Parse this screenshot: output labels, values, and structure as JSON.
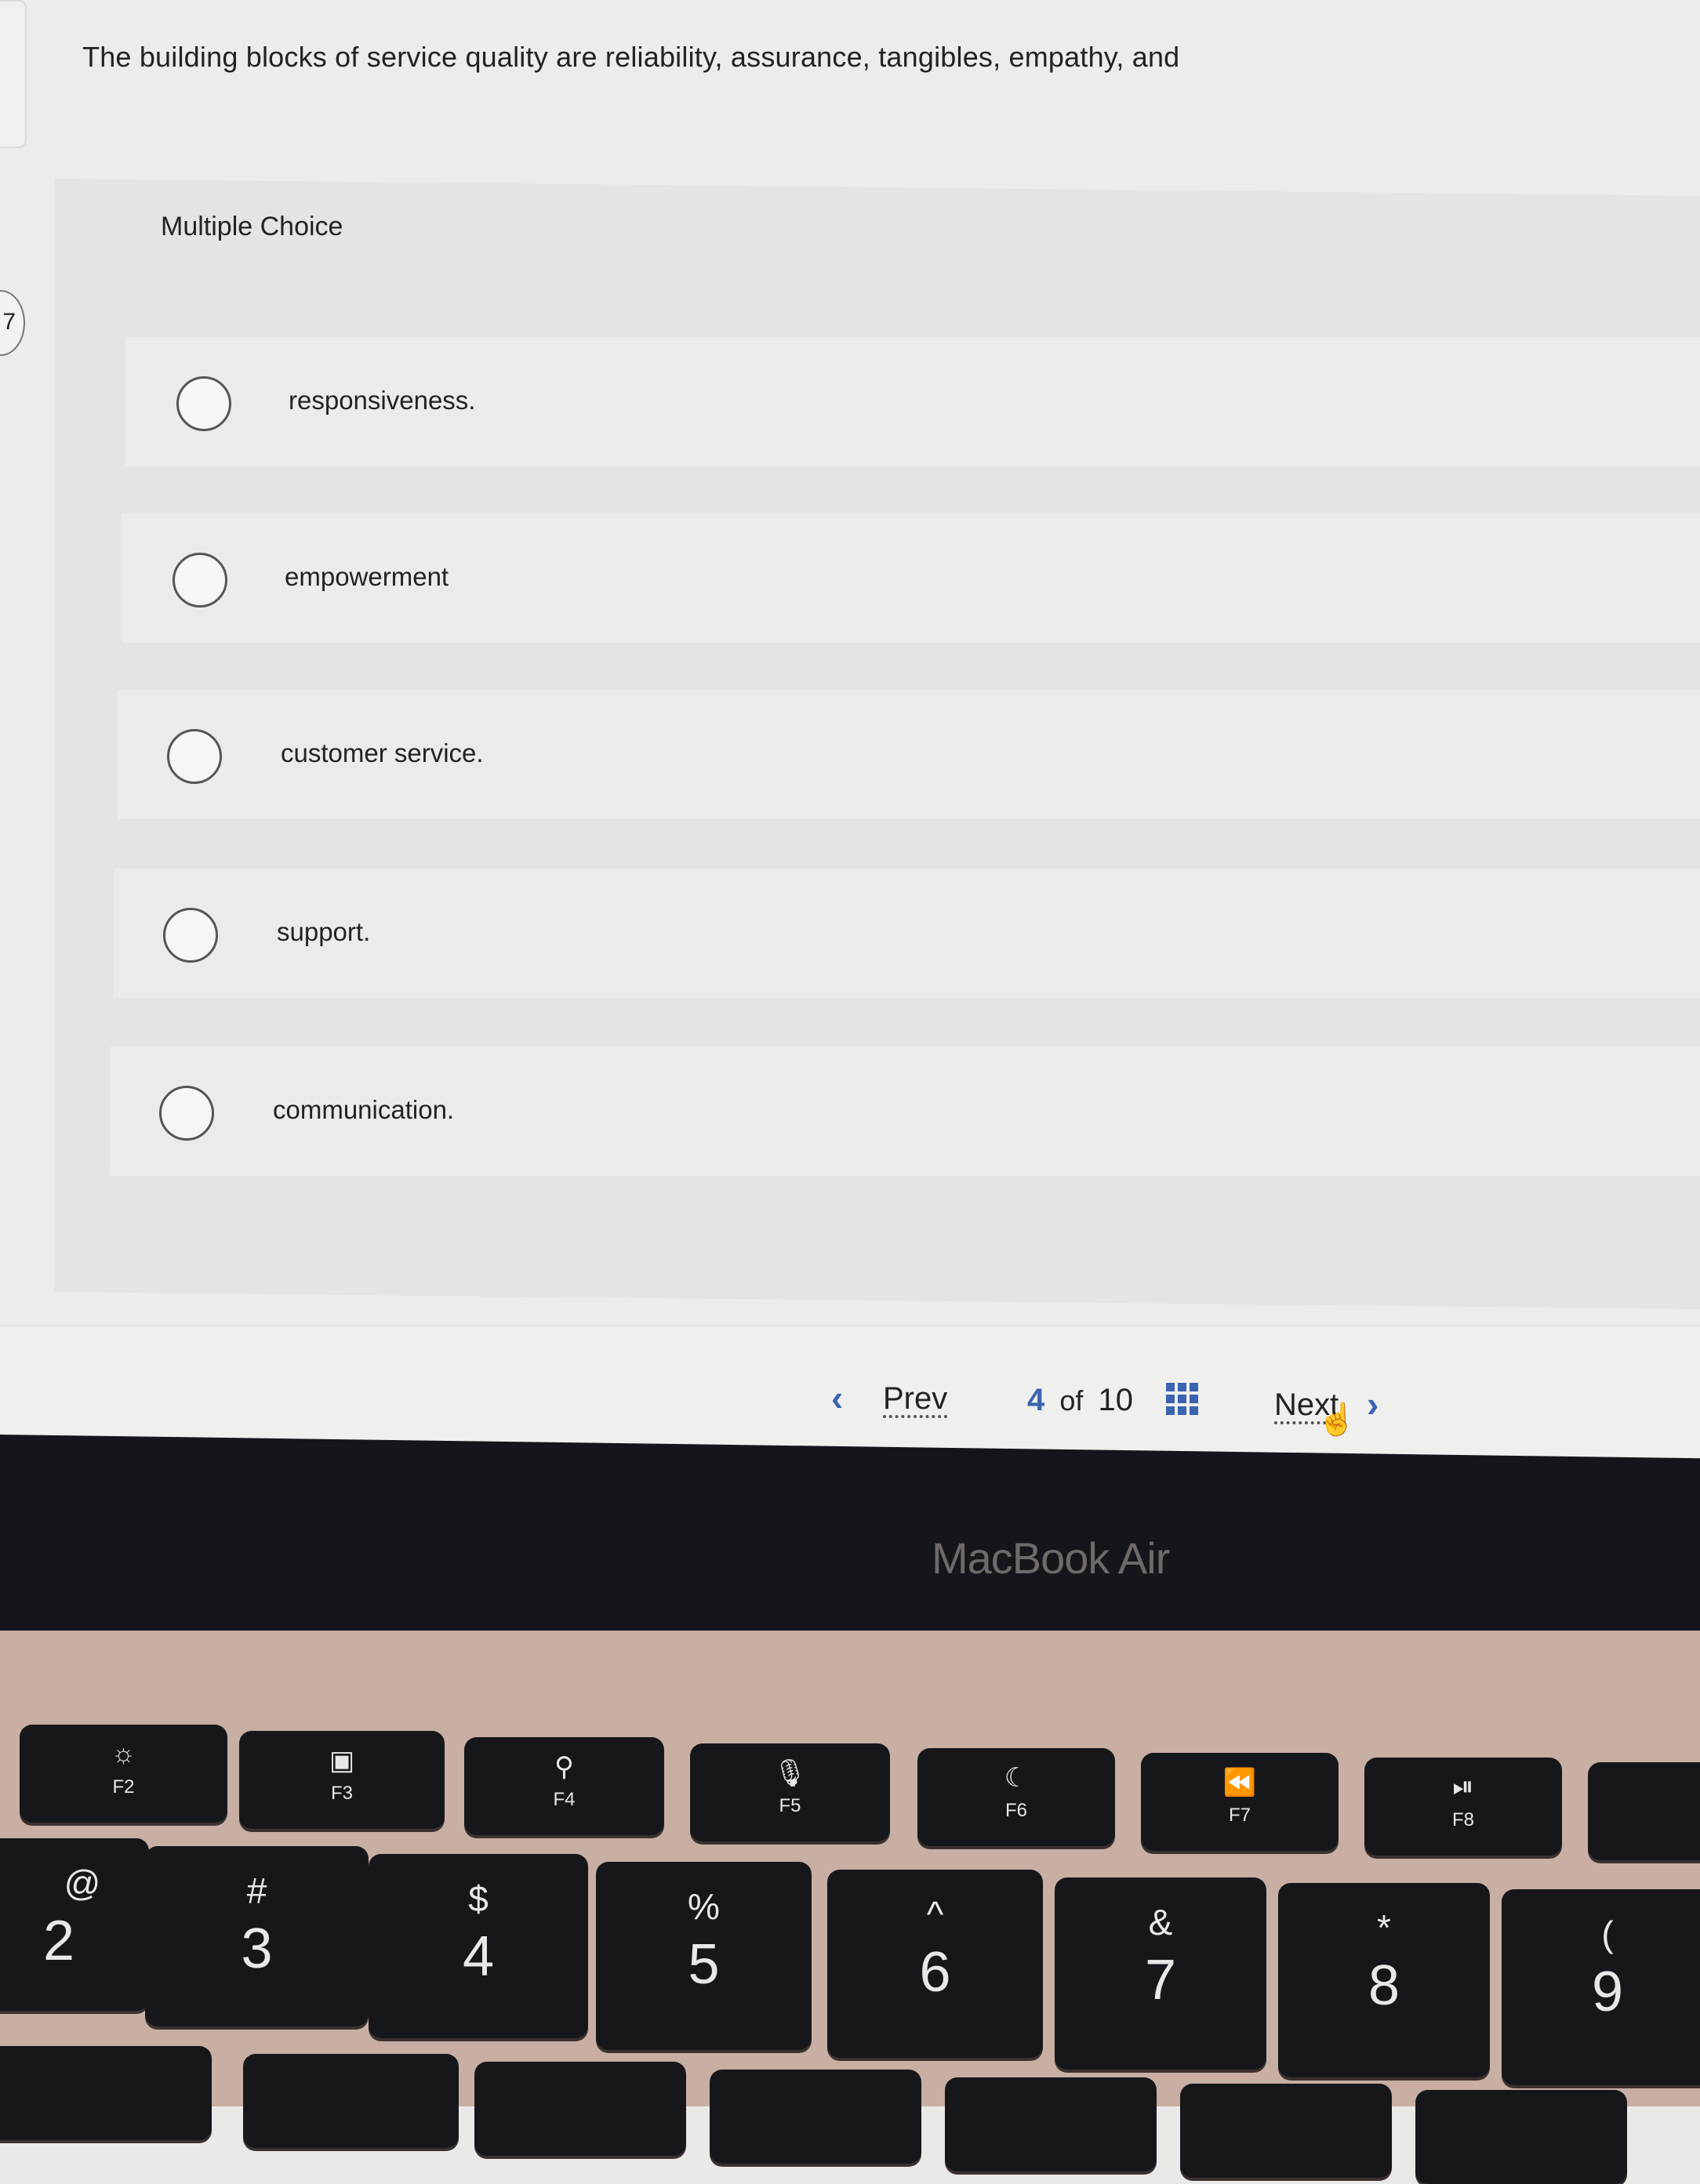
{
  "question": {
    "number": "7",
    "text": "The building blocks of service quality are reliability, assurance, tangibles, empathy, and",
    "type_label": "Multiple Choice"
  },
  "choices": [
    {
      "label": "responsiveness."
    },
    {
      "label": "empowerment"
    },
    {
      "label": "customer service."
    },
    {
      "label": "support."
    },
    {
      "label": "communication."
    }
  ],
  "navigation": {
    "prev_icon": "‹",
    "prev_label": "Prev",
    "current_page": "4",
    "of_label": "of",
    "total_pages": "10",
    "grid_icon": "grid-icon",
    "next_label": "Next",
    "next_icon": "›",
    "cursor_icon": "☝"
  },
  "device": {
    "brand_label": "MacBook Air"
  },
  "keyboard": {
    "function_keys": [
      {
        "symbol": "☼",
        "label": "F2"
      },
      {
        "symbol": "▣",
        "label": "F3"
      },
      {
        "symbol": "⚲",
        "label": "F4"
      },
      {
        "symbol": "🎙",
        "label": "F5"
      },
      {
        "symbol": "☾",
        "label": "F6"
      },
      {
        "symbol": "⏪",
        "label": "F7"
      },
      {
        "symbol": "⏯",
        "label": "F8"
      }
    ],
    "number_keys": [
      {
        "top": "@",
        "bottom": "2"
      },
      {
        "top": "#",
        "bottom": "3"
      },
      {
        "top": "$",
        "bottom": "4"
      },
      {
        "top": "%",
        "bottom": "5"
      },
      {
        "top": "^",
        "bottom": "6"
      },
      {
        "top": "&",
        "bottom": "7"
      },
      {
        "top": "*",
        "bottom": "8"
      },
      {
        "top": "(",
        "bottom": "9"
      }
    ]
  },
  "colors": {
    "accent": "#3a63b0",
    "bezel": "#14161c",
    "deck": "#c8aea3"
  }
}
